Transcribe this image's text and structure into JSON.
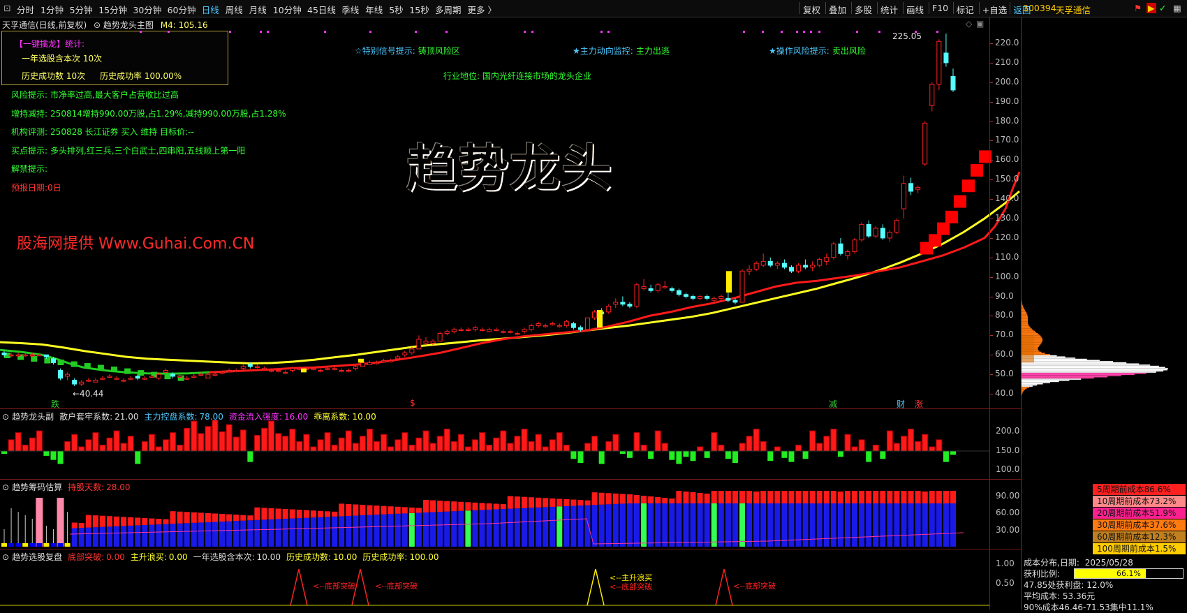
{
  "toolbar": {
    "periods": [
      "分时",
      "1分钟",
      "5分钟",
      "15分钟",
      "30分钟",
      "60分钟",
      "日线",
      "周线",
      "月线",
      "10分钟",
      "45日线",
      "季线",
      "年线",
      "5秒",
      "15秒",
      "多周期",
      "更多 〉"
    ],
    "active_period": "日线",
    "right": [
      "复权",
      "叠加",
      "多股",
      "统计",
      "画线",
      "F10",
      "标记",
      "+自选",
      "返回"
    ],
    "stock_code": "300394",
    "stock_name": "天孚通信"
  },
  "main_panel": {
    "header_name": "天孚通信(日线,前复权)",
    "indicator_name": "趋势龙头主图",
    "indicator_value": "M4: 105.16",
    "info_box": {
      "title": "【一键擒龙】统计:",
      "line1": "一年选股含本次 10次",
      "line2a": "历史成功数 10次",
      "line2b": "历史成功率 100.00%"
    },
    "signals": [
      {
        "label": "☆特别信号提示:",
        "value": "铸顶风险区"
      },
      {
        "label": "★主力动向监控:",
        "value": "主力出逃"
      },
      {
        "label": "★操作风险提示:",
        "value": "卖出风险"
      }
    ],
    "industry": "行业地位: 国内光纤连接市场的龙头企业",
    "notes": [
      {
        "label": "风险提示:",
        "value": "市净率过高,最大客户占营收比过高",
        "color": "#33ff33"
      },
      {
        "label": "增持减持:",
        "value": "250814增持990.00万股,占1.29%,减持990.00万股,占1.28%",
        "color": "#33ff33"
      },
      {
        "label": "机构评测:",
        "value": "250828 长江证券 买入 维持 目标价:--",
        "color": "#33ff33"
      },
      {
        "label": "买点提示:",
        "value": "多头排列,红三兵,三个白武士,四串阳,五线顺上第一阳",
        "color": "#33ff33"
      },
      {
        "label": "解禁提示:",
        "value": "",
        "color": "#33ff33"
      },
      {
        "label": "预报日期:0日",
        "value": "",
        "color": "#ff3333"
      }
    ],
    "big_title": "趋势龙头",
    "watermark": "股海网提供 Www.Guhai.Com.CN",
    "high_label": "225.05",
    "low_label": "←40.44",
    "price_axis": [
      "220.0",
      "210.0",
      "200.0",
      "190.0",
      "180.0",
      "170.0",
      "160.0",
      "150.0",
      "140.0",
      "130.0",
      "120.0",
      "110.0",
      "100.0",
      "90.0",
      "80.0",
      "70.0",
      "60.0",
      "50.0",
      "40.0"
    ],
    "markers": [
      {
        "text": "跌",
        "color": "#33cc33"
      },
      {
        "text": "$",
        "color": "#ff3333"
      },
      {
        "text": "减",
        "color": "#33cc33"
      },
      {
        "text": "财",
        "color": "#4ec9ff"
      },
      {
        "text": "涨",
        "color": "#ff3333"
      }
    ]
  },
  "sub1": {
    "name": "趋势龙头副",
    "items": [
      {
        "label": "散户套牢系数:",
        "value": "21.00",
        "color": "#dddddd"
      },
      {
        "label": "主力控盘系数:",
        "value": "78.00",
        "color": "#4ec9ff"
      },
      {
        "label": "资金流入强度:",
        "value": "16.00",
        "color": "#ff33ff"
      },
      {
        "label": "乖离系数:",
        "value": "10.00",
        "color": "#ffff33"
      }
    ],
    "axis": [
      "200.0",
      "150.0",
      "100.0"
    ]
  },
  "sub2": {
    "name": "趋势筹码估算",
    "items": [
      {
        "label": "持股天数:",
        "value": "28.00",
        "color": "#ff3333"
      }
    ],
    "axis": [
      "90.00",
      "60.00",
      "30.00"
    ]
  },
  "sub3": {
    "name": "趋势选股复盘",
    "items": [
      {
        "label": "底部突破:",
        "value": "0.00",
        "color": "#ff3333"
      },
      {
        "label": "主升浪买:",
        "value": "0.00",
        "color": "#ffff33"
      },
      {
        "label": "一年选股含本次:",
        "value": "10.00",
        "color": "#dddddd"
      },
      {
        "label": "历史成功数:",
        "value": "10.00",
        "color": "#ffff33"
      },
      {
        "label": "历史成功率:",
        "value": "100.00",
        "color": "#ffff33"
      }
    ],
    "axis": [
      "1.00",
      "0.50"
    ],
    "annotations": [
      "底部突破",
      "底部突破",
      "主升浪买",
      "底部突破",
      "底部突破"
    ]
  },
  "cost_distribution": {
    "rows": [
      {
        "label": "5周期前成本86.6%",
        "color": "#ff2020"
      },
      {
        "label": "10周期前成本73.2%",
        "color": "#ff8888"
      },
      {
        "label": "20周期前成本51.9%",
        "color": "#ff2090"
      },
      {
        "label": "30周期前成本37.6%",
        "color": "#ff7a10"
      },
      {
        "label": "60周期前成本12.3%",
        "color": "#c08020"
      },
      {
        "label": "100周期前成本1.5%",
        "color": "#ffcc00"
      }
    ],
    "date_label": "成本分布,日期:",
    "date": "2025/05/28",
    "profit_label": "获利比例:",
    "profit_ratio": "66.1%",
    "profit_fraction": 0.661,
    "line3": "47.85处获利盘: 12.0%",
    "line4": "平均成本: 53.36元",
    "line5": "90%成本46.46-71.53集中11.1%"
  },
  "chart_data": {
    "type": "candlestick",
    "price_min": 40,
    "price_max": 225,
    "candles": [
      [
        61,
        62,
        59,
        60
      ],
      [
        60,
        61,
        59,
        60
      ],
      [
        60,
        61,
        59,
        60
      ],
      [
        60,
        61,
        59,
        60
      ],
      [
        60,
        61,
        59,
        60
      ],
      [
        60,
        61,
        60,
        60
      ],
      [
        60,
        60,
        58,
        59
      ],
      [
        58,
        59,
        55,
        56
      ],
      [
        52,
        53,
        47,
        48
      ],
      [
        49,
        51,
        47,
        50
      ],
      [
        47,
        48,
        44,
        45
      ],
      [
        45,
        47,
        44,
        46
      ],
      [
        47,
        48,
        46,
        47
      ],
      [
        46,
        48,
        46,
        47
      ],
      [
        48,
        49,
        47,
        48
      ],
      [
        49,
        50,
        48,
        49
      ],
      [
        48,
        49,
        47,
        48
      ],
      [
        47,
        48,
        46,
        47
      ],
      [
        48,
        49,
        47,
        48
      ],
      [
        49,
        50,
        47,
        48
      ],
      [
        48,
        49,
        47,
        48
      ],
      [
        49,
        50,
        48,
        49
      ],
      [
        48,
        51,
        47,
        50
      ],
      [
        51,
        53,
        50,
        52
      ],
      [
        50,
        51,
        48,
        49
      ],
      [
        49,
        50,
        48,
        49
      ],
      [
        48,
        49,
        47,
        48
      ],
      [
        49,
        50,
        48,
        49
      ],
      [
        50,
        51,
        49,
        50
      ],
      [
        48,
        51,
        48,
        50
      ],
      [
        50,
        51,
        49,
        50
      ],
      [
        51,
        52,
        50,
        51
      ],
      [
        52,
        53,
        51,
        52
      ],
      [
        52,
        53,
        51,
        52
      ],
      [
        53,
        55,
        52,
        54
      ],
      [
        55,
        56,
        53,
        54
      ],
      [
        54,
        55,
        53,
        54
      ],
      [
        53,
        54,
        52,
        53
      ],
      [
        52,
        53,
        51,
        52
      ],
      [
        52,
        53,
        51,
        52
      ],
      [
        51,
        52,
        50,
        51
      ],
      [
        52,
        54,
        51,
        53
      ],
      [
        53,
        54,
        52,
        53
      ],
      [
        53,
        54,
        52,
        53
      ],
      [
        53,
        54,
        52,
        53
      ],
      [
        52,
        53,
        51,
        52
      ],
      [
        53,
        54,
        52,
        53
      ],
      [
        53,
        54,
        52,
        53
      ],
      [
        52,
        53,
        51,
        52
      ],
      [
        52,
        53,
        51,
        52
      ],
      [
        53,
        55,
        52,
        54
      ],
      [
        54,
        57,
        54,
        56
      ],
      [
        55,
        57,
        55,
        56
      ],
      [
        56,
        57,
        55,
        56
      ],
      [
        57,
        58,
        56,
        57
      ],
      [
        57,
        58,
        56,
        57
      ],
      [
        58,
        60,
        57,
        59
      ],
      [
        60,
        62,
        59,
        61
      ],
      [
        61,
        64,
        60,
        63
      ],
      [
        63,
        70,
        63,
        68
      ],
      [
        66,
        69,
        65,
        67
      ],
      [
        66,
        68,
        65,
        67
      ],
      [
        67,
        72,
        67,
        71
      ],
      [
        71,
        73,
        70,
        72
      ],
      [
        72,
        74,
        71,
        73
      ],
      [
        73,
        74,
        72,
        73
      ],
      [
        73,
        74,
        72,
        73
      ],
      [
        73,
        75,
        72,
        74
      ],
      [
        73,
        74,
        72,
        73
      ],
      [
        72,
        74,
        72,
        73
      ],
      [
        73,
        74,
        72,
        73
      ],
      [
        72,
        73,
        71,
        72
      ],
      [
        72,
        73,
        71,
        72
      ],
      [
        71,
        72,
        70,
        71
      ],
      [
        72,
        74,
        71,
        73
      ],
      [
        73,
        76,
        72,
        75
      ],
      [
        75,
        77,
        74,
        76
      ],
      [
        75,
        76,
        74,
        75
      ],
      [
        76,
        77,
        75,
        76
      ],
      [
        75,
        76,
        74,
        75
      ],
      [
        75,
        78,
        74,
        77
      ],
      [
        76,
        77,
        73,
        74
      ],
      [
        74,
        75,
        72,
        73
      ],
      [
        73,
        79,
        73,
        79
      ],
      [
        79,
        83,
        78,
        82
      ],
      [
        82,
        84,
        80,
        81
      ],
      [
        82,
        86,
        81,
        85
      ],
      [
        86,
        89,
        84,
        87
      ],
      [
        87,
        90,
        85,
        86
      ],
      [
        86,
        87,
        84,
        85
      ],
      [
        85,
        97,
        84,
        96
      ],
      [
        94,
        99,
        93,
        95
      ],
      [
        94,
        96,
        92,
        93
      ],
      [
        93,
        97,
        92,
        96
      ],
      [
        95,
        98,
        94,
        95
      ],
      [
        94,
        95,
        92,
        93
      ],
      [
        93,
        94,
        90,
        91
      ],
      [
        91,
        92,
        89,
        90
      ],
      [
        90,
        91,
        88,
        89
      ],
      [
        89,
        91,
        88,
        90
      ],
      [
        90,
        91,
        88,
        89
      ],
      [
        88,
        90,
        87,
        89
      ],
      [
        89,
        91,
        87,
        90
      ],
      [
        89,
        92,
        87,
        88
      ],
      [
        88,
        89,
        86,
        87
      ],
      [
        87,
        104,
        87,
        103
      ],
      [
        103,
        106,
        101,
        104
      ],
      [
        104,
        108,
        103,
        107
      ],
      [
        106,
        112,
        105,
        108
      ],
      [
        108,
        110,
        105,
        106
      ],
      [
        106,
        108,
        104,
        107
      ],
      [
        107,
        109,
        104,
        105
      ],
      [
        105,
        106,
        102,
        103
      ],
      [
        103,
        107,
        102,
        106
      ],
      [
        106,
        109,
        104,
        105
      ],
      [
        105,
        108,
        103,
        106
      ],
      [
        106,
        110,
        105,
        109
      ],
      [
        108,
        112,
        106,
        110
      ],
      [
        110,
        118,
        109,
        117
      ],
      [
        117,
        120,
        111,
        112
      ],
      [
        111,
        114,
        109,
        113
      ],
      [
        113,
        120,
        112,
        119
      ],
      [
        119,
        128,
        118,
        127
      ],
      [
        127,
        129,
        120,
        121
      ],
      [
        121,
        126,
        120,
        125
      ],
      [
        125,
        127,
        119,
        120
      ],
      [
        120,
        124,
        118,
        123
      ],
      [
        123,
        130,
        122,
        129
      ],
      [
        135,
        152,
        130,
        148
      ],
      [
        148,
        151,
        142,
        144
      ],
      [
        145,
        147,
        143,
        146
      ],
      [
        158,
        180,
        157,
        179
      ],
      [
        188,
        200,
        185,
        199
      ],
      [
        199,
        222,
        196,
        221
      ],
      [
        215,
        225,
        208,
        210
      ],
      [
        203,
        207,
        195,
        196
      ]
    ],
    "ma_slow": [
      [
        0,
        66.5
      ],
      [
        30,
        66
      ],
      [
        60,
        65.3
      ],
      [
        90,
        63.8
      ],
      [
        120,
        62
      ],
      [
        150,
        60.5
      ],
      [
        180,
        59
      ],
      [
        210,
        58
      ],
      [
        240,
        57.5
      ],
      [
        270,
        57
      ],
      [
        300,
        56.5
      ],
      [
        330,
        56
      ],
      [
        360,
        55.6
      ],
      [
        390,
        55.8
      ],
      [
        420,
        56.5
      ],
      [
        450,
        57.5
      ],
      [
        480,
        58.8
      ],
      [
        510,
        60
      ],
      [
        540,
        61.5
      ],
      [
        570,
        63
      ],
      [
        600,
        64.5
      ],
      [
        630,
        65.5
      ],
      [
        660,
        66.5
      ],
      [
        690,
        67.5
      ],
      [
        720,
        68.3
      ],
      [
        750,
        69.2
      ],
      [
        780,
        70.1
      ],
      [
        810,
        71.2
      ],
      [
        840,
        72.5
      ],
      [
        870,
        73.8
      ],
      [
        900,
        75
      ],
      [
        930,
        76.5
      ],
      [
        960,
        78
      ],
      [
        990,
        79.5
      ],
      [
        1020,
        81.5
      ],
      [
        1050,
        84
      ],
      [
        1080,
        86.5
      ],
      [
        1110,
        89
      ],
      [
        1140,
        91.5
      ],
      [
        1170,
        94
      ],
      [
        1200,
        97
      ],
      [
        1230,
        100
      ],
      [
        1260,
        103.5
      ],
      [
        1290,
        107.5
      ],
      [
        1320,
        112
      ],
      [
        1350,
        117
      ],
      [
        1380,
        123
      ],
      [
        1410,
        130
      ],
      [
        1440,
        138
      ],
      [
        1460,
        144
      ]
    ],
    "ma_trend": [
      [
        0,
        62.5
      ],
      [
        30,
        61.5
      ],
      [
        60,
        60
      ],
      [
        80,
        58
      ],
      [
        100,
        55.5
      ],
      [
        120,
        53.5
      ],
      [
        150,
        52
      ],
      [
        180,
        51
      ],
      [
        210,
        50.5
      ],
      [
        240,
        50.3
      ],
      [
        270,
        50.5
      ],
      [
        300,
        51
      ],
      [
        330,
        51.5
      ],
      [
        360,
        52
      ],
      [
        390,
        52.5
      ],
      [
        420,
        53.2
      ],
      [
        450,
        53.5
      ],
      [
        480,
        54.2
      ],
      [
        510,
        55
      ],
      [
        540,
        56
      ],
      [
        570,
        57.5
      ],
      [
        600,
        59.2
      ],
      [
        630,
        61
      ],
      [
        660,
        63.5
      ],
      [
        690,
        66
      ],
      [
        720,
        68
      ],
      [
        750,
        69.5
      ],
      [
        780,
        70.5
      ],
      [
        810,
        71.5
      ],
      [
        840,
        72.5
      ],
      [
        870,
        74.5
      ],
      [
        900,
        77
      ],
      [
        930,
        80
      ],
      [
        960,
        82
      ],
      [
        990,
        84.5
      ],
      [
        1020,
        86.5
      ],
      [
        1050,
        89
      ],
      [
        1080,
        92
      ],
      [
        1110,
        95
      ],
      [
        1140,
        97
      ],
      [
        1170,
        98
      ],
      [
        1200,
        99.5
      ],
      [
        1230,
        101
      ],
      [
        1260,
        103
      ],
      [
        1290,
        105
      ],
      [
        1320,
        108
      ],
      [
        1350,
        111
      ],
      [
        1380,
        115
      ],
      [
        1410,
        120
      ],
      [
        1425,
        126
      ],
      [
        1440,
        135
      ],
      [
        1450,
        145
      ],
      [
        1460,
        154
      ]
    ]
  }
}
